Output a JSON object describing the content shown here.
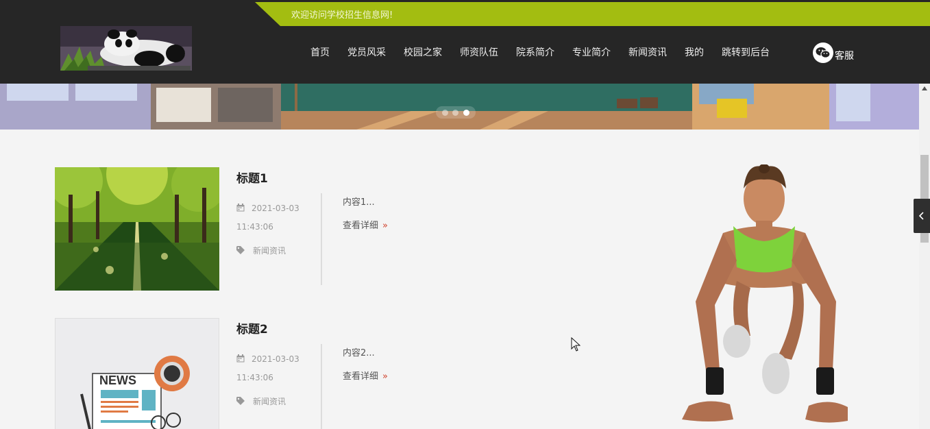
{
  "topbar": {
    "welcome": "欢迎访问学校招生信息网!"
  },
  "nav": {
    "items": [
      "首页",
      "党员风采",
      "校园之家",
      "师资队伍",
      "院系简介",
      "专业简介",
      "新闻资讯",
      "我的",
      "跳转到后台"
    ],
    "service_label": "客服"
  },
  "banner": {
    "slide_count": 3,
    "active_slide": 3
  },
  "news": [
    {
      "title": "标题1",
      "date": "2021-03-03",
      "time": "11:43:06",
      "category": "新闻资讯",
      "excerpt": "内容1...",
      "more": "查看详细"
    },
    {
      "title": "标题2",
      "date": "2021-03-03",
      "time": "11:43:06",
      "category": "新闻资讯",
      "excerpt": "内容2...",
      "more": "查看详细"
    }
  ],
  "thumbnail_text": {
    "news_badge": "NEWS"
  },
  "colors": {
    "accent_green": "#a3bd11",
    "header_bg": "#262626",
    "arrow_red": "#d0432e",
    "page_bg": "#f4f4f4"
  },
  "icons": [
    "calendar-icon",
    "tag-icon",
    "wechat-icon",
    "chevron-left-icon",
    "double-chevron-right-icon"
  ]
}
